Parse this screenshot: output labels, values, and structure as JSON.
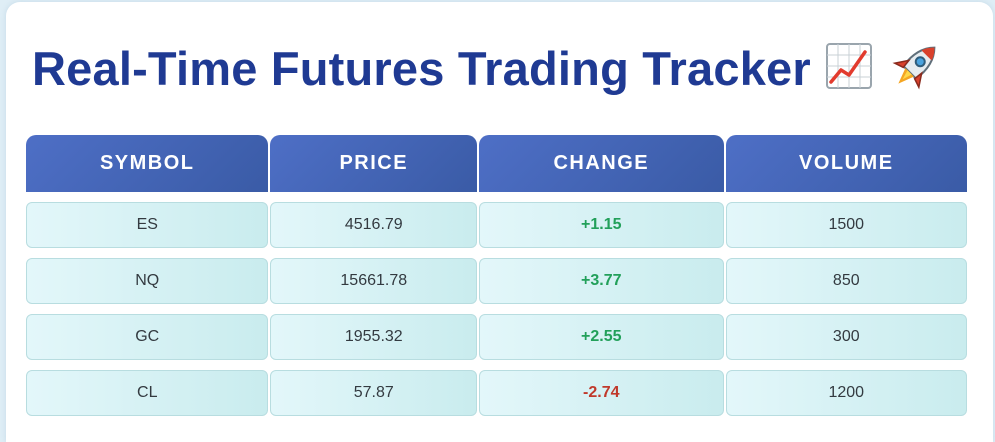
{
  "page": {
    "title": "Real-Time Futures Trading Tracker"
  },
  "icons": [
    "chart-increasing-icon",
    "rocket-icon"
  ],
  "colors": {
    "title": "#1f3a93",
    "header": "#4e6fc6",
    "positive": "#22a05a",
    "negative": "#c0392b"
  },
  "table": {
    "headers": [
      "SYMBOL",
      "PRICE",
      "CHANGE",
      "VOLUME"
    ],
    "rows": [
      {
        "symbol": "ES",
        "price": "4516.79",
        "change": "+1.15",
        "volume": "1500",
        "direction": "up"
      },
      {
        "symbol": "NQ",
        "price": "15661.78",
        "change": "+3.77",
        "volume": "850",
        "direction": "up"
      },
      {
        "symbol": "GC",
        "price": "1955.32",
        "change": "+2.55",
        "volume": "300",
        "direction": "up"
      },
      {
        "symbol": "CL",
        "price": "57.87",
        "change": "-2.74",
        "volume": "1200",
        "direction": "down"
      }
    ]
  }
}
